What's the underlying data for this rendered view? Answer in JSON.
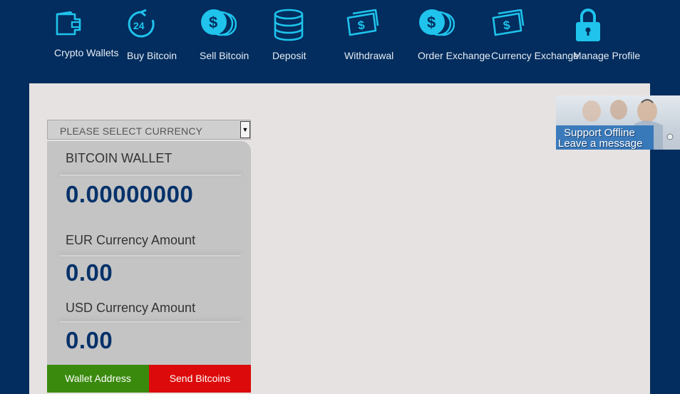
{
  "nav": {
    "items": [
      {
        "label": "Crypto Wallets",
        "icon": "wallet-icon"
      },
      {
        "label": "Buy Bitcoin",
        "icon": "clock-24-icon"
      },
      {
        "label": "Sell Bitcoin",
        "icon": "coins-icon"
      },
      {
        "label": "Deposit",
        "icon": "database-icon"
      },
      {
        "label": "Withdrawal",
        "icon": "banknote-icon"
      },
      {
        "label": "Order Exchange",
        "icon": "coins-icon"
      },
      {
        "label": "Currency Exchange",
        "icon": "banknote-icon"
      },
      {
        "label": "Manage Profile",
        "icon": "lock-icon"
      }
    ],
    "icon_color": "#1fc3ec"
  },
  "currency_select": {
    "value": "PLEASE SELECT CURRENCY",
    "arrow": "▼"
  },
  "wallet": {
    "title": "BITCOIN WALLET",
    "btc_balance": "0.00000000",
    "eur_label": "EUR Currency Amount",
    "eur_value": "0.00",
    "usd_label": "USD Currency Amount",
    "usd_value": "0.00"
  },
  "actions": {
    "wallet_address": "Wallet Address",
    "send_bitcoins": "Send Bitcoins"
  },
  "support": {
    "line1": "Support Offline",
    "line2": "Leave a message"
  },
  "colors": {
    "background": "#022d5e",
    "panel": "#e6e2e1",
    "wallet_value": "#07326a",
    "wallet_address_button": "#3a8a0e",
    "send_button": "#dc0a0a"
  }
}
